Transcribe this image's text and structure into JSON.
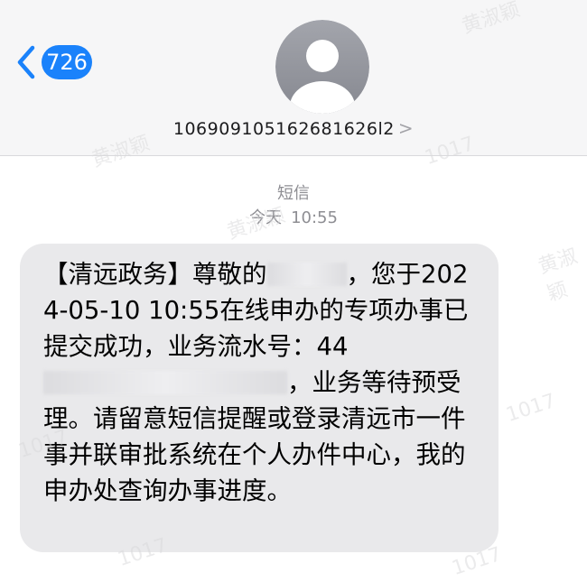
{
  "header": {
    "back_badge_count": "726",
    "contact_number": "106909105162681626l2",
    "contact_chevron": ">"
  },
  "thread": {
    "message_type": "短信",
    "day_label": "今天",
    "time_label": "10:55"
  },
  "message": {
    "text_part1": "【清远政务】尊敬的",
    "text_part2": "，您于2024-05-10 10:55在线申办的专项办事已提交成功，业务流水号：44",
    "text_part3": "，业务等待预受理。请留意短信提醒或登录清远市一件事并联审批系统在个人办件中心，我的申办处查询办事进度。"
  },
  "watermarks": {
    "name": "黄淑颖",
    "code": "1017"
  },
  "colors": {
    "badge_blue": "#1a82fb",
    "header_bg": "#f6f6f7",
    "bubble_bg": "#e9e9eb",
    "meta_gray": "#8e8e93"
  },
  "icons": {
    "back": "chevron-left-icon",
    "avatar": "person-avatar-icon",
    "contact_detail": "chevron-right-icon"
  }
}
